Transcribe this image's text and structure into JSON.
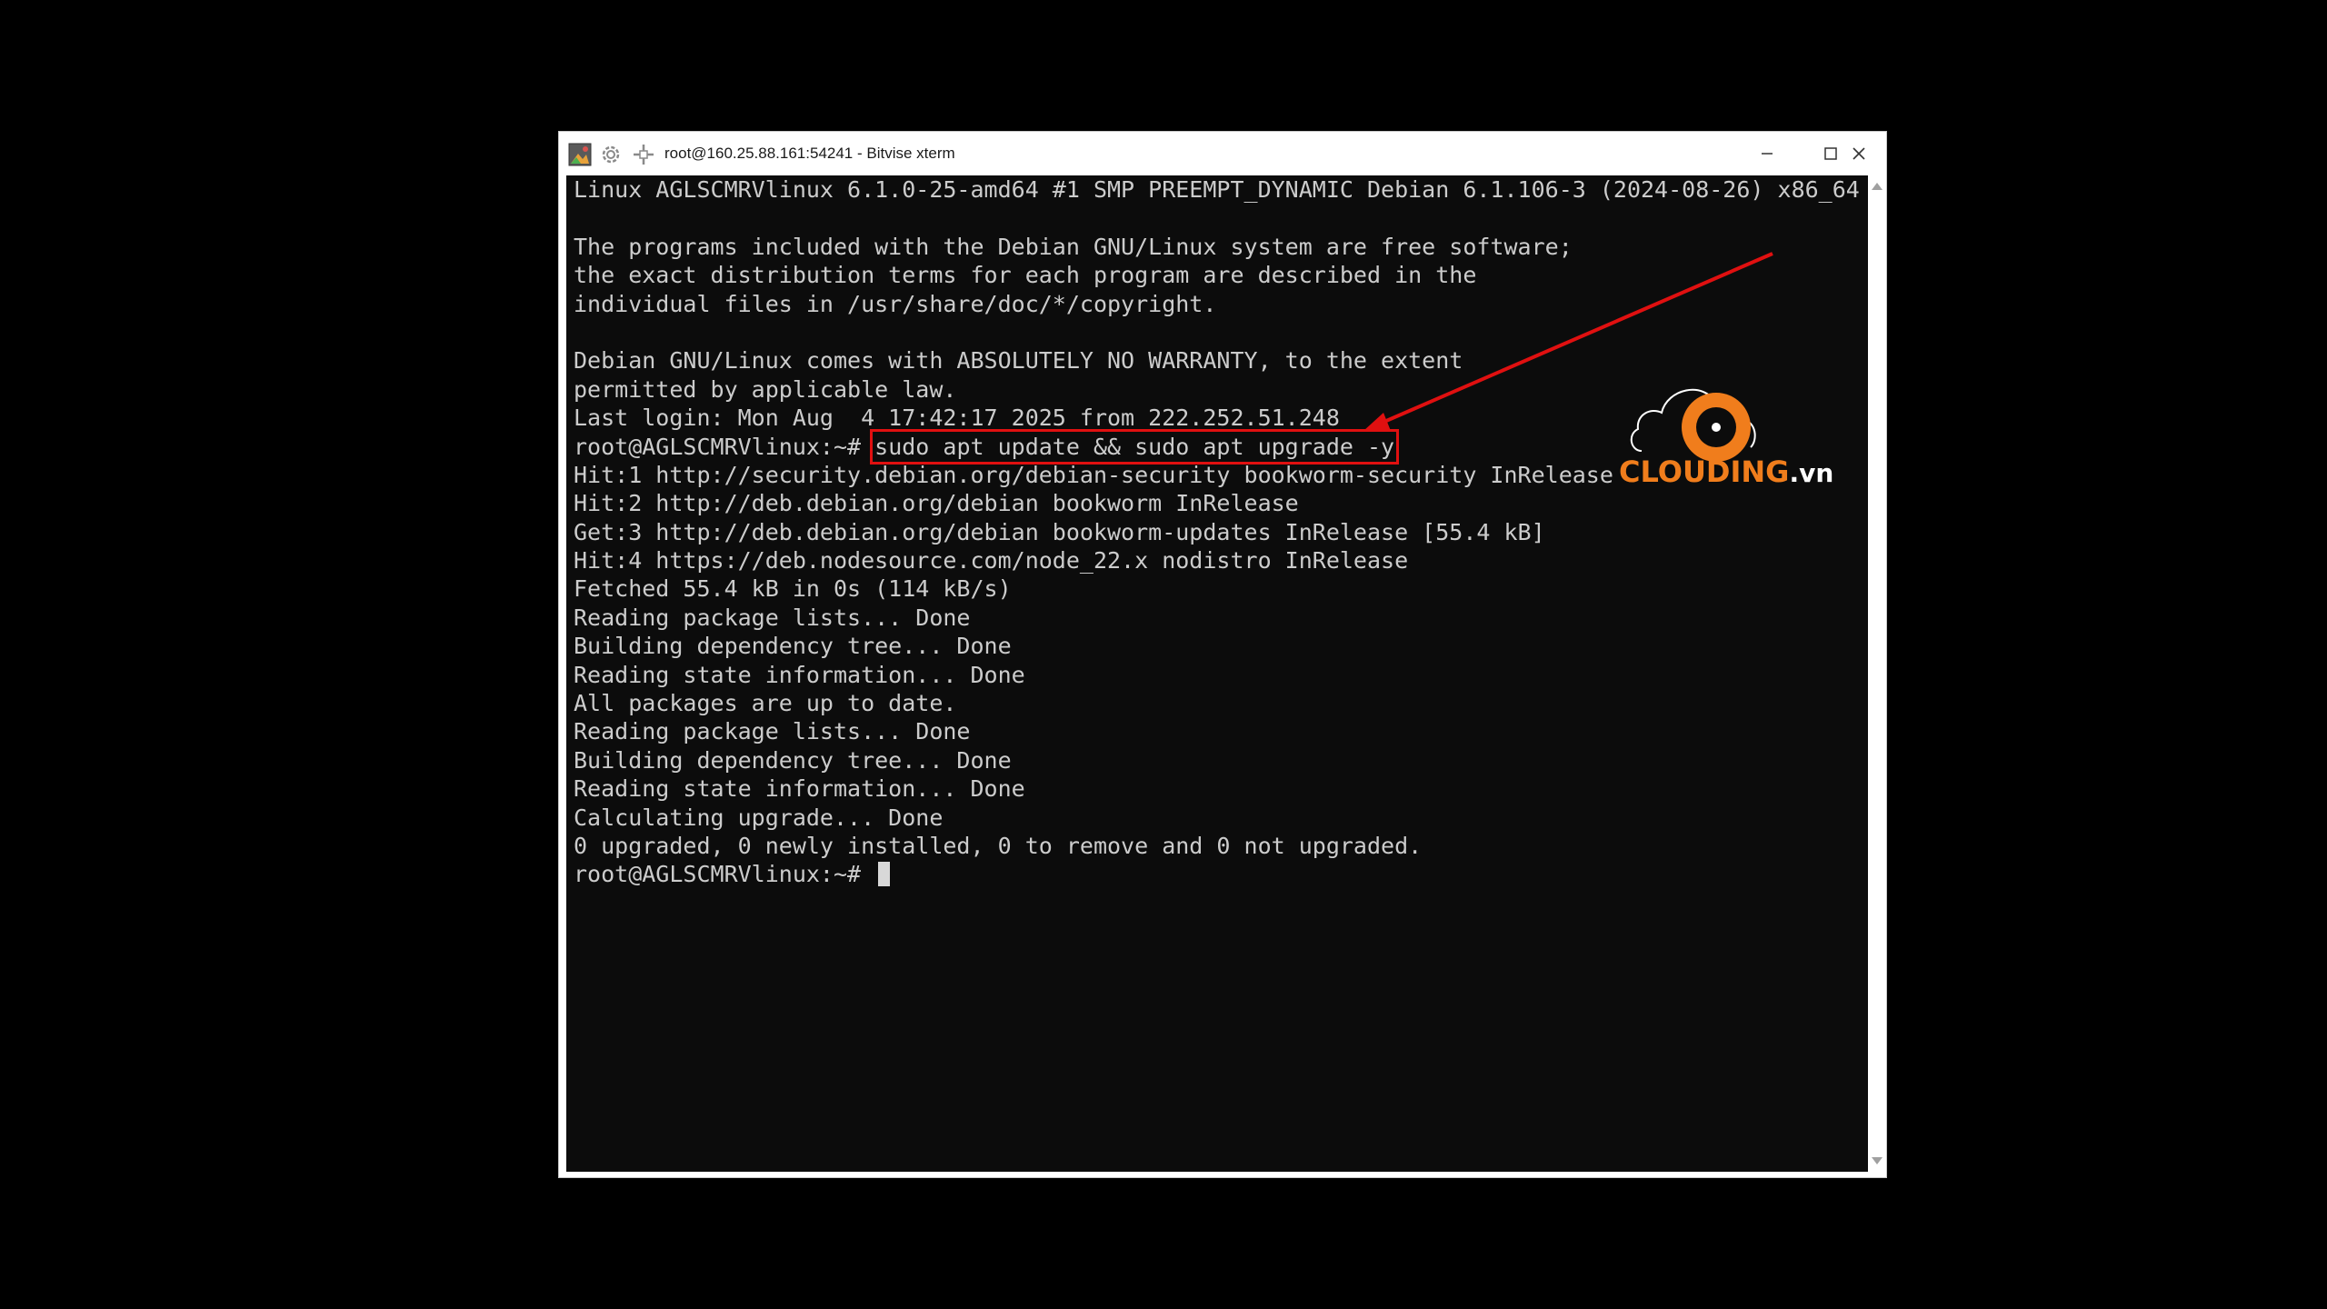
{
  "window": {
    "title": "root@160.25.88.161:54241 - Bitvise xterm",
    "icons": [
      "app-icon",
      "gear-icon",
      "move-icon"
    ],
    "controls": [
      "minimize-icon",
      "maximize-icon",
      "close-icon"
    ]
  },
  "terminal": {
    "lines": [
      "Linux AGLSCMRVlinux 6.1.0-25-amd64 #1 SMP PREEMPT_DYNAMIC Debian 6.1.106-3 (2024-08-26) x86_64",
      "",
      "The programs included with the Debian GNU/Linux system are free software;",
      "the exact distribution terms for each program are described in the",
      "individual files in /usr/share/doc/*/copyright.",
      "",
      "Debian GNU/Linux comes with ABSOLUTELY NO WARRANTY, to the extent",
      "permitted by applicable law.",
      "Last login: Mon Aug  4 17:42:17 2025 from 222.252.51.248"
    ],
    "command_prompt": "root@AGLSCMRVlinux:~# ",
    "command": "sudo apt update && sudo apt upgrade -y",
    "output": [
      "Hit:1 http://security.debian.org/debian-security bookworm-security InRelease",
      "Hit:2 http://deb.debian.org/debian bookworm InRelease",
      "Get:3 http://deb.debian.org/debian bookworm-updates InRelease [55.4 kB]",
      "Hit:4 https://deb.nodesource.com/node_22.x nodistro InRelease",
      "Fetched 55.4 kB in 0s (114 kB/s)",
      "Reading package lists... Done",
      "Building dependency tree... Done",
      "Reading state information... Done",
      "All packages are up to date.",
      "Reading package lists... Done",
      "Building dependency tree... Done",
      "Reading state information... Done",
      "Calculating upgrade... Done",
      "0 upgraded, 0 newly installed, 0 to remove and 0 not upgraded."
    ],
    "final_prompt": "root@AGLSCMRVlinux:~# "
  },
  "annotation": {
    "highlight_color": "#e01010",
    "arrow_color": "#e01010"
  },
  "logo": {
    "brand": "CLOUDING",
    "suffix": ".vn",
    "brand_color": "#f07d1c"
  },
  "colors": {
    "terminal_bg": "#0c0c0c",
    "terminal_fg": "#cccccc",
    "page_bg": "#000000"
  }
}
